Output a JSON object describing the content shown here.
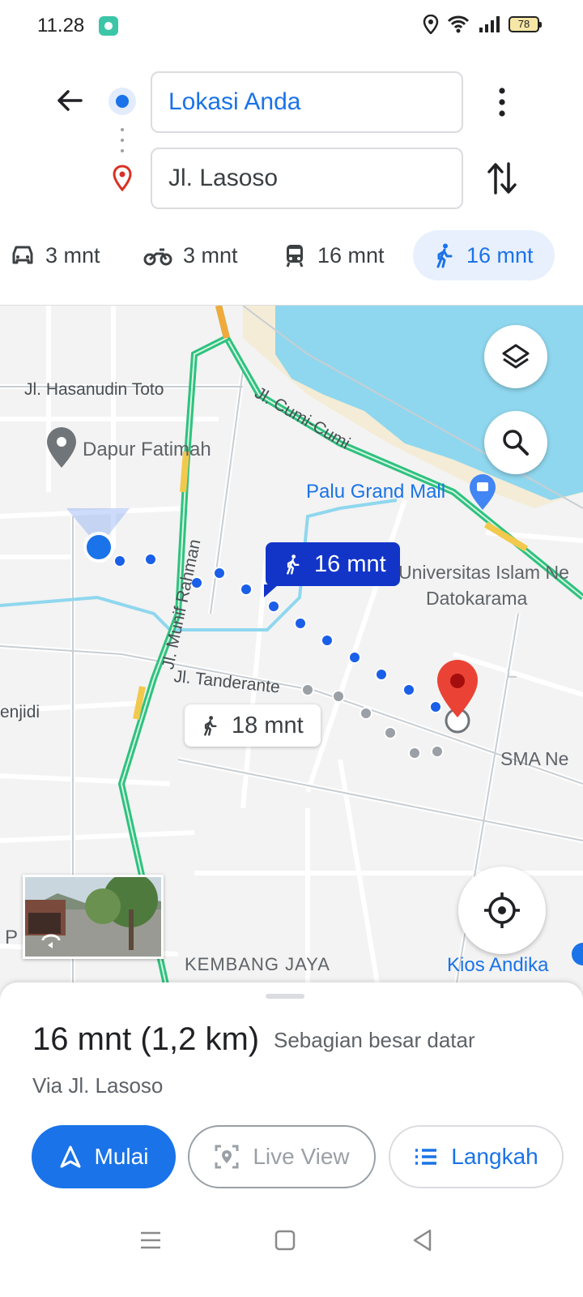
{
  "status_bar": {
    "time": "11.28",
    "battery": "78"
  },
  "search": {
    "origin": "Lokasi Anda",
    "destination": "Jl. Lasoso"
  },
  "modes": [
    {
      "icon": "car-icon",
      "label": "3 mnt"
    },
    {
      "icon": "motorcycle-icon",
      "label": "3 mnt"
    },
    {
      "icon": "transit-icon",
      "label": "16 mnt"
    },
    {
      "icon": "walk-icon",
      "label": "16 mnt",
      "active": true
    }
  ],
  "map": {
    "labels": {
      "hasanudin": "Jl. Hasanudin Toto",
      "dapur": "Dapur Fatimah",
      "cumi": "Jl. Cumi-Cumi",
      "mall": "Palu Grand Mall",
      "univ1": "Universitas Islam Ne",
      "univ2": "Datokarama",
      "munif": "Jl. Munif Rahman",
      "tanderante": "Jl. Tanderante",
      "menjidi": "enjidi",
      "sma": "SMA Ne",
      "kembang": "KEMBANG JAYA",
      "kios": "Kios Andika",
      "p": "P"
    },
    "route_main": "16 mnt",
    "route_alt": "18 mnt"
  },
  "sheet": {
    "duration": "16 mnt (1,2 km)",
    "terrain": "Sebagian besar datar",
    "via": "Via Jl. Lasoso",
    "start": "Mulai",
    "live_view": "Live View",
    "steps": "Langkah"
  },
  "colors": {
    "accent": "#1a73e8",
    "route": "#1235c8",
    "water": "#8fd7ee"
  }
}
